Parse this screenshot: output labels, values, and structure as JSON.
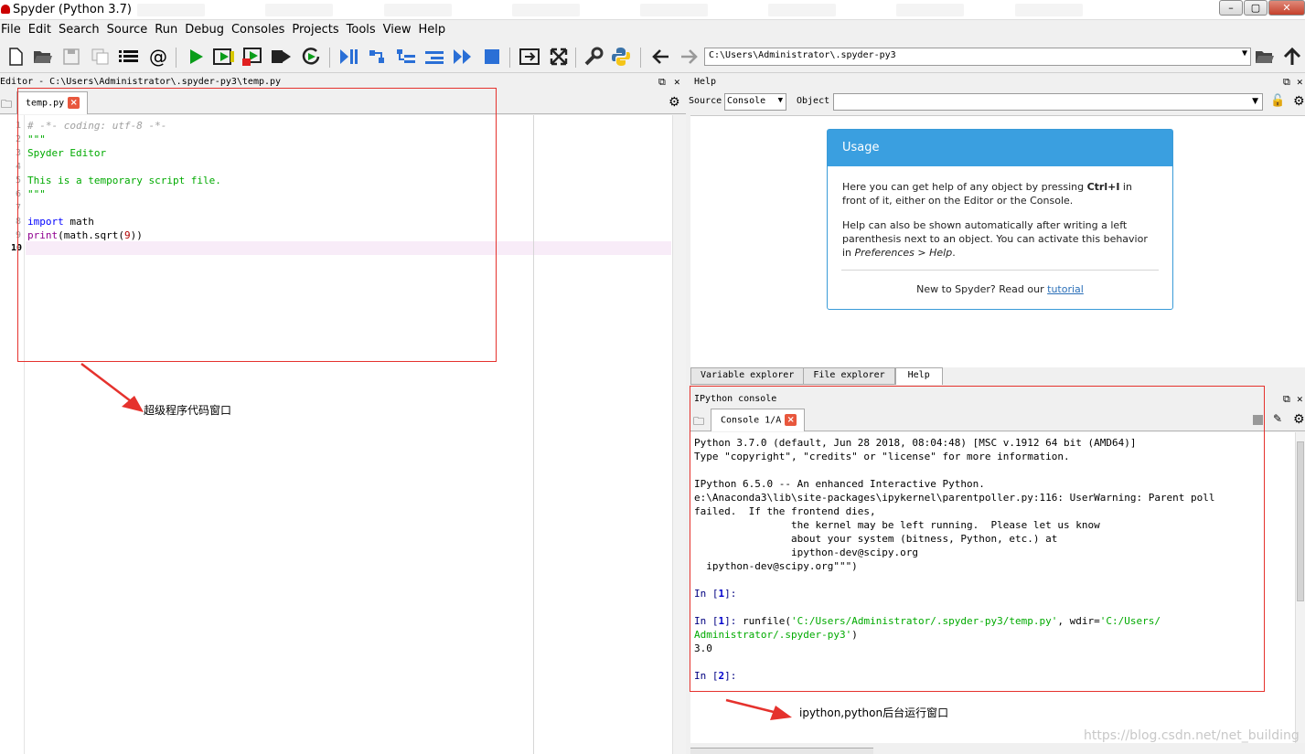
{
  "window": {
    "title": "Spyder (Python 3.7)",
    "min": "–",
    "max": "▢",
    "close": "✕"
  },
  "menu": [
    "File",
    "Edit",
    "Search",
    "Source",
    "Run",
    "Debug",
    "Consoles",
    "Projects",
    "Tools",
    "View",
    "Help"
  ],
  "toolbar": {
    "path": "C:\\Users\\Administrator\\.spyder-py3",
    "icons": [
      "new-file-icon",
      "open-file-icon",
      "save-icon",
      "save-all-icon",
      "outline-icon",
      "at-icon",
      "run-icon",
      "run-cell-icon",
      "run-cell-advance-icon",
      "run-selection-icon",
      "rerun-icon",
      "debug-icon",
      "step-icon",
      "step-into-icon",
      "step-return-icon",
      "continue-icon",
      "stop-icon",
      "maximize-pane-icon",
      "fullscreen-icon",
      "wrench-icon",
      "python-icon",
      "back-arrow-icon",
      "forward-arrow-icon",
      "browse-folder-icon",
      "parent-dir-icon"
    ]
  },
  "editor": {
    "title": "Editor - C:\\Users\\Administrator\\.spyder-py3\\temp.py",
    "tab": "temp.py",
    "lines": [
      {
        "n": "1",
        "text": "# -*- coding: utf-8 -*-",
        "color": "#a0a0a0"
      },
      {
        "n": "2",
        "text": "\"\"\"",
        "color": "#00aa00"
      },
      {
        "n": "3",
        "text": "Spyder Editor",
        "color": "#00aa00"
      },
      {
        "n": "4",
        "text": "",
        "color": "#00aa00"
      },
      {
        "n": "5",
        "text": "This is a temporary script file.",
        "color": "#00aa00"
      },
      {
        "n": "6",
        "text": "\"\"\"",
        "color": "#00aa00"
      },
      {
        "n": "7",
        "text": "",
        "color": "#000000"
      },
      {
        "n": "8",
        "text": "",
        "color": "#000000"
      },
      {
        "n": "9",
        "text": "",
        "color": "#000000"
      },
      {
        "n": "10",
        "text": "",
        "color": "#000000"
      }
    ],
    "line8": {
      "kw": "import",
      "rest": " math"
    },
    "line9": {
      "fn": "print",
      "rest": "(math.sqrt(",
      "num": "9",
      "end": "))"
    }
  },
  "help": {
    "title": "Help",
    "source_label": "Source",
    "source_value": "Console",
    "object_label": "Object",
    "usage_title": "Usage",
    "p1a": "Here you can get help of any object by pressing ",
    "p1b": "Ctrl+I",
    "p1c": " in front of it, either on the Editor or the Console.",
    "p2a": "Help can also be shown automatically after writing a left parenthesis next to an object. You can activate this behavior in ",
    "p2b": "Preferences > Help",
    "p2c": ".",
    "new_text": "New to Spyder? Read our ",
    "tutorial": "tutorial",
    "tabs": [
      "Variable explorer",
      "File explorer",
      "Help"
    ]
  },
  "console": {
    "title": "IPython console",
    "tab": "Console 1/A",
    "l1": "Python 3.7.0 (default, Jun 28 2018, 08:04:48) [MSC v.1912 64 bit (AMD64)]",
    "l2": "Type \"copyright\", \"credits\" or \"license\" for more information.",
    "l3": "IPython 6.5.0 -- An enhanced Interactive Python.",
    "l4": "e:\\Anaconda3\\lib\\site-packages\\ipykernel\\parentpoller.py:116: UserWarning: Parent poll",
    "l5": "failed.  If the frontend dies,",
    "l6": "                the kernel may be left running.  Please let us know",
    "l7": "                about your system (bitness, Python, etc.) at",
    "l8": "                ipython-dev@scipy.org",
    "l9": "  ipython-dev@scipy.org\"\"\")",
    "in1": "In [",
    "in1n": "1",
    "in1e": "]:",
    "run_fn": " runfile(",
    "run_s1": "'C:/Users/Administrator/.spyder-py3/temp.py'",
    "run_mid": ", wdir=",
    "run_s2": "'C:/Users/",
    "run_s3": "Administrator/.spyder-py3'",
    "run_end": ")",
    "out": "3.0",
    "in2n": "2"
  },
  "annotations": {
    "editor_note": "超级程序代码窗口",
    "console_note": "ipython,python后台运行窗口",
    "watermark": "https://blog.csdn.net/net_building"
  },
  "colors": {
    "accent": "#3a9fe0",
    "annotation_red": "#e5322d",
    "prompt_blue": "#000080",
    "string_green": "#00aa00"
  }
}
